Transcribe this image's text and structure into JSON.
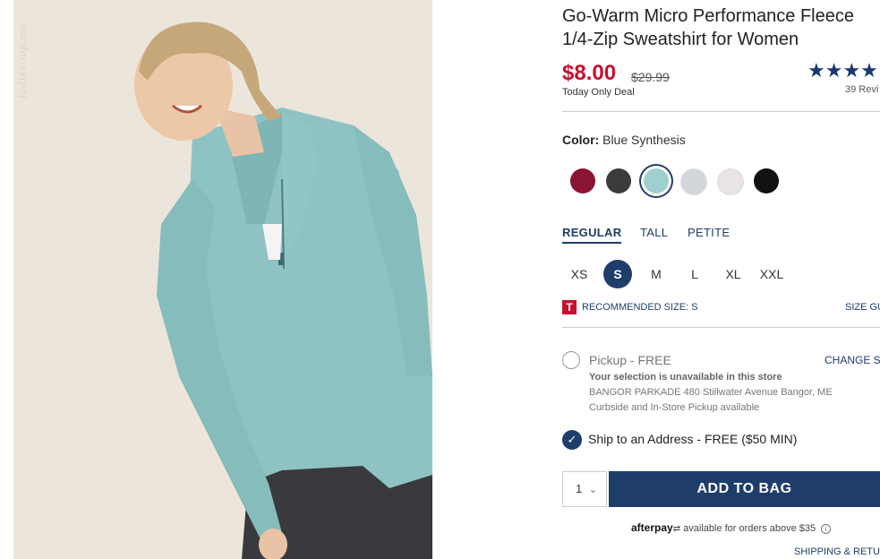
{
  "product": {
    "title": "Go-Warm Micro Performance Fleece\n1/4-Zip Sweatshirt for Women",
    "price": "$8.00",
    "original_price": "$29.99",
    "deal_label": "Today Only Deal",
    "stars": "★★★★",
    "reviews": "39 Revi",
    "watermark": "ladies-top.me"
  },
  "color": {
    "label": "Color:",
    "value": "Blue Synthesis",
    "swatches": [
      {
        "name": "burgundy",
        "hex": "#8b1432"
      },
      {
        "name": "charcoal",
        "hex": "#3b3a3c"
      },
      {
        "name": "blue-synthesis",
        "hex": "#9fd0d0"
      },
      {
        "name": "light-gray",
        "hex": "#d3d7da"
      },
      {
        "name": "pale-lilac",
        "hex": "#e9e3e8"
      },
      {
        "name": "black",
        "hex": "#111111"
      }
    ]
  },
  "fit_tabs": [
    "REGULAR",
    "TALL",
    "PETITE"
  ],
  "sizes": [
    "XS",
    "S",
    "M",
    "L",
    "XL",
    "XXL"
  ],
  "recommended": {
    "badge": "T",
    "label": "RECOMMENDED SIZE: S",
    "size_guide": "SIZE GU"
  },
  "pickup": {
    "label": "Pickup - FREE",
    "change_store": "CHANGE ST",
    "unavailable": "Your selection is unavailable in this store",
    "store_line1": "BANGOR PARKADE 480 Stillwater Avenue  Bangor, ME",
    "store_line2": "Curbside and In-Store Pickup available"
  },
  "ship": {
    "label": "Ship to an Address - FREE ($50 MIN)",
    "check": "✓"
  },
  "cart": {
    "qty": "1",
    "qty_arrow": "⌄",
    "add_label": "ADD TO BAG"
  },
  "afterpay": {
    "brand": "afterpay",
    "text": "available for orders above $35",
    "info": "i"
  },
  "shipping_returns": "SHIPPING & RETU",
  "colors": {
    "accent": "#1f3d6b",
    "price_red": "#c8102e"
  }
}
